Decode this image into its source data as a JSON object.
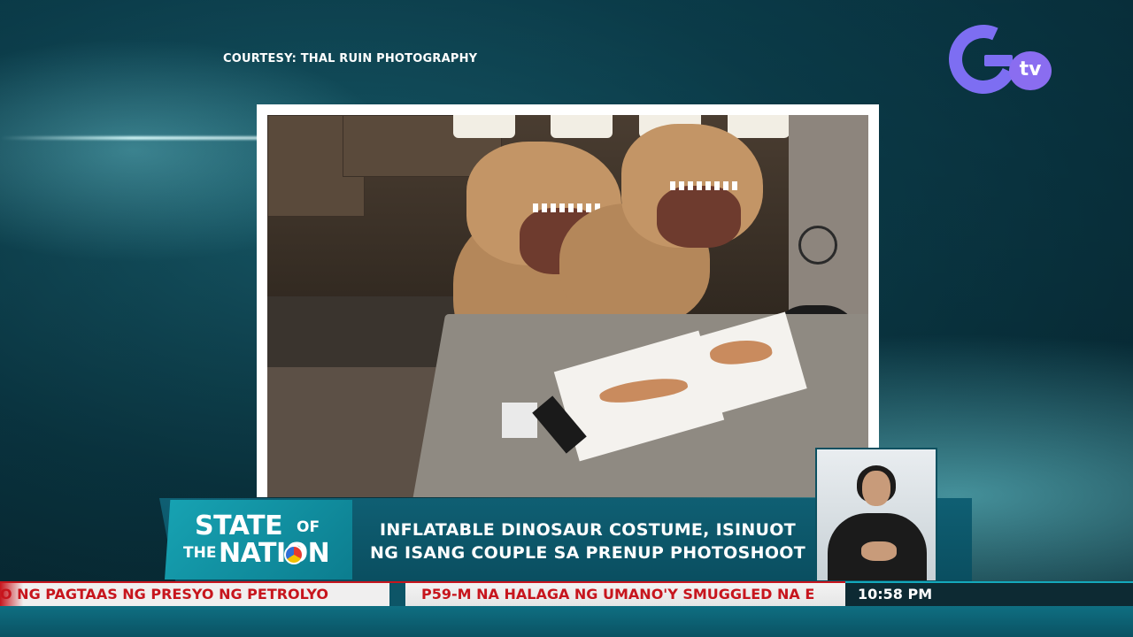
{
  "courtesy": "COURTESY: THAL RUIN PHOTOGRAPHY",
  "channel": {
    "logo_letter": "G",
    "logo_sub": "tv"
  },
  "show": {
    "state": "STATE",
    "of": "OF",
    "the": "THE",
    "nation": "NATION"
  },
  "headline": {
    "line1": "INFLATABLE DINOSAUR COSTUME, ISINUOT",
    "line2": "NG ISANG COUPLE SA PRENUP PHOTOSHOOT"
  },
  "ticker": {
    "item1": "O NG PAGTAAS NG PRESYO NG PETROLYO",
    "item2": "P59-M NA HALAGA NG UMANO'Y SMUGGLED NA E"
  },
  "time": "10:58 PM",
  "colors": {
    "accent_teal": "#14a9bc",
    "ticker_red": "#c7151d",
    "bg_dark": "#062d3a"
  }
}
